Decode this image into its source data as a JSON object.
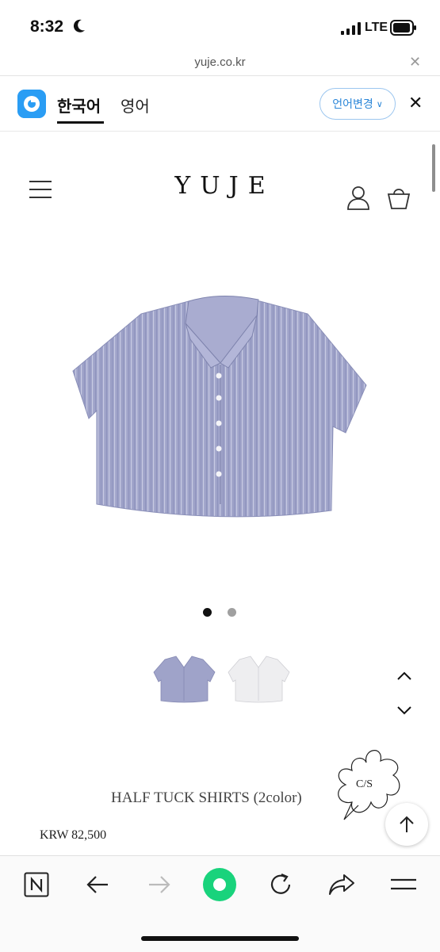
{
  "status_bar": {
    "time": "8:32",
    "network": "LTE"
  },
  "browser": {
    "url": "yuje.co.kr"
  },
  "translate_bar": {
    "active_language": "한국어",
    "other_language": "영어",
    "change_language_label": "언어변경"
  },
  "site": {
    "logo": "YUJE"
  },
  "gallery": {
    "current_index": 1,
    "total": 2
  },
  "product": {
    "name": "HALF TUCK SHIRTS (2color)",
    "price": "KRW 82,500"
  },
  "floating": {
    "cs_label": "C/S"
  },
  "colors": {
    "shirt_blue": "#9fa3c9",
    "shirt_white": "#eeeef0",
    "accent": "#2a9df4",
    "go_button": "#19d37c"
  }
}
